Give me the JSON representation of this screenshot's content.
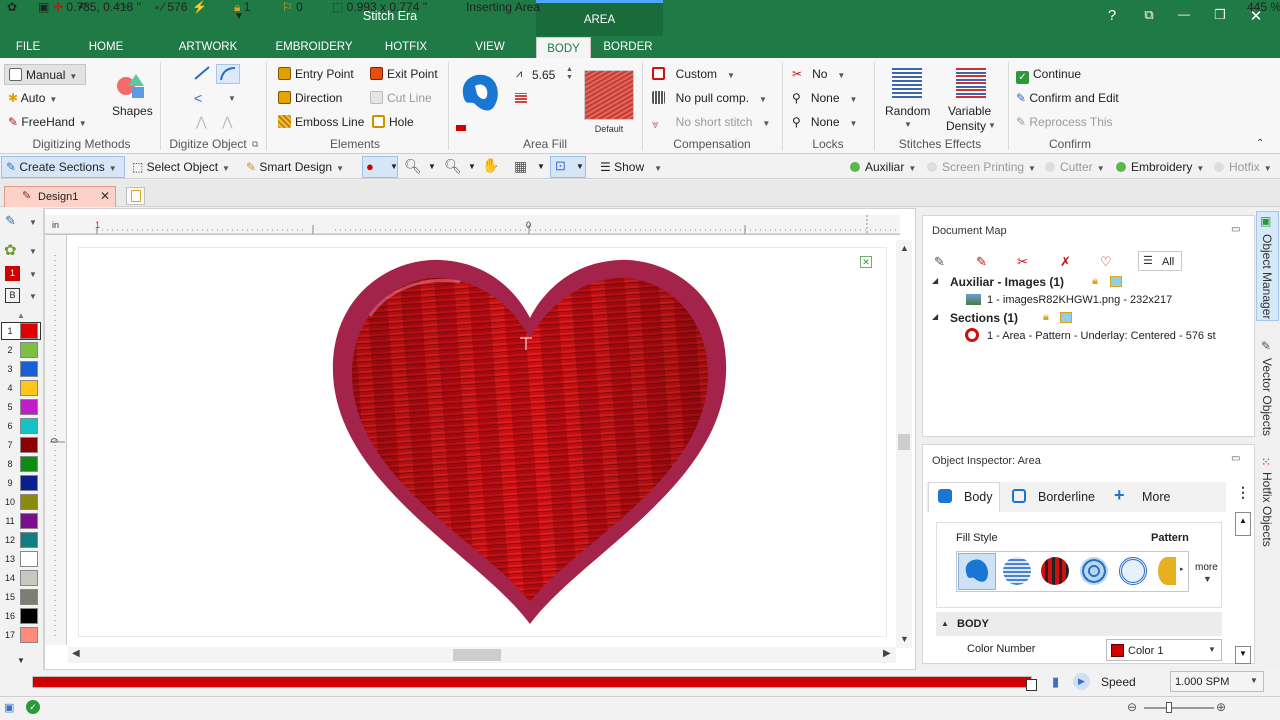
{
  "app": {
    "title": "Stitch Era",
    "context_group": "AREA"
  },
  "quick_access": [
    "app-icon",
    "save-icon",
    "undo-icon",
    "redo-icon",
    "more-icon",
    "bolt-icon",
    "customize-icon"
  ],
  "window_controls": {
    "help": "?",
    "restore_ribbon": "⧉",
    "minimize": "—",
    "maximize": "❐",
    "close": "✕"
  },
  "tabs": [
    {
      "label": "FILE"
    },
    {
      "label": "HOME"
    },
    {
      "label": "ARTWORK"
    },
    {
      "label": "EMBROIDERY"
    },
    {
      "label": "HOTFIX"
    },
    {
      "label": "VIEW"
    },
    {
      "label": "BODY"
    },
    {
      "label": "BORDER"
    }
  ],
  "active_tab": "BODY",
  "ribbon": {
    "digitizing_methods": {
      "label": "Digitizing Methods",
      "manual": "Manual",
      "auto": "Auto",
      "freehand": "FreeHand",
      "shapes": "Shapes"
    },
    "digitize_object": {
      "label": "Digitize Object"
    },
    "elements": {
      "label": "Elements",
      "entry_point": "Entry Point",
      "exit_point": "Exit Point",
      "direction": "Direction",
      "cut_line": "Cut Line",
      "emboss_line": "Emboss Line",
      "hole": "Hole"
    },
    "area_fill": {
      "label": "Area Fill",
      "density": "5.65",
      "preset": "Default"
    },
    "compensation": {
      "label": "Compensation",
      "custom": "Custom",
      "no_pull": "No pull comp.",
      "no_short": "No short stitch"
    },
    "locks": {
      "label": "Locks",
      "no": "No",
      "none1": "None",
      "none2": "None"
    },
    "stitches_effects": {
      "label": "Stitches Effects",
      "random": "Random",
      "variable_density_1": "Variable",
      "variable_density_2": "Density"
    },
    "confirm": {
      "label": "Confirm",
      "continue": "Continue",
      "confirm_edit": "Confirm and Edit",
      "reprocess": "Reprocess This"
    }
  },
  "toolbar2": {
    "create_sections": "Create Sections",
    "select_object": "Select Object",
    "smart_design": "Smart Design",
    "show": "Show",
    "auxiliar": "Auxiliar",
    "screen_printing": "Screen Printing",
    "cutter": "Cutter",
    "embroidery": "Embroidery",
    "hotfix": "Hotfix"
  },
  "document_tab": {
    "label": "Design1"
  },
  "ruler": {
    "unit": "in",
    "mark1": "1",
    "mark0": "0"
  },
  "left_tools": {
    "color_selected": "1",
    "b_label": "B"
  },
  "palette": [
    {
      "n": "1",
      "color": "#e00000"
    },
    {
      "n": "2",
      "color": "#7ac142"
    },
    {
      "n": "3",
      "color": "#1560d4"
    },
    {
      "n": "4",
      "color": "#ffc61a"
    },
    {
      "n": "5",
      "color": "#c21bc8"
    },
    {
      "n": "6",
      "color": "#13c4c6"
    },
    {
      "n": "7",
      "color": "#8b0000"
    },
    {
      "n": "8",
      "color": "#0f8a12"
    },
    {
      "n": "9",
      "color": "#0a1f8f"
    },
    {
      "n": "10",
      "color": "#8b8a0f"
    },
    {
      "n": "11",
      "color": "#7a0f8b"
    },
    {
      "n": "12",
      "color": "#0f7e7e"
    },
    {
      "n": "13",
      "color": "#ffffff"
    },
    {
      "n": "14",
      "color": "#c8c8c0"
    },
    {
      "n": "15",
      "color": "#7d7d78"
    },
    {
      "n": "16",
      "color": "#000000"
    },
    {
      "n": "17",
      "color": "#ff8a7a"
    }
  ],
  "doc_map": {
    "title": "Document Map",
    "filter_all": "All",
    "auxiliar_header": "Auxiliar - Images (1)",
    "auxiliar_item": "1 - imagesR82KHGW1.png - 232x217",
    "sections_header": "Sections (1)",
    "sections_item": "1 - Area - Pattern - Underlay: Centered - 576 st"
  },
  "inspector": {
    "title": "Object Inspector: Area",
    "tab_body": "Body",
    "tab_borderline": "Borderline",
    "tab_more": "More",
    "fill_style_label": "Fill Style",
    "fill_style_value": "Pattern",
    "more_label": "more",
    "section_body": "BODY",
    "color_number_label": "Color Number",
    "color_value": "Color 1"
  },
  "side_tabs": {
    "object_manager": "Object Manager",
    "vector_objects": "Vector Objects",
    "hotfix_objects": "Hotfix Objects"
  },
  "progress": {
    "fill": 1.0,
    "speed_label": "Speed",
    "speed_value": "1.000 SPM"
  },
  "status": {
    "coords": "0.785, 0.418 ''",
    "stitches": "576",
    "count1": "1",
    "count2": "0",
    "size": "0.993 x 0.774 ''",
    "mode": "Inserting Area",
    "zoom": "445 %"
  },
  "colors": {
    "brand": "#1f7a45",
    "heart_red": "#c40f14",
    "heart_border": "#a3234a",
    "progress_red": "#d10000"
  }
}
